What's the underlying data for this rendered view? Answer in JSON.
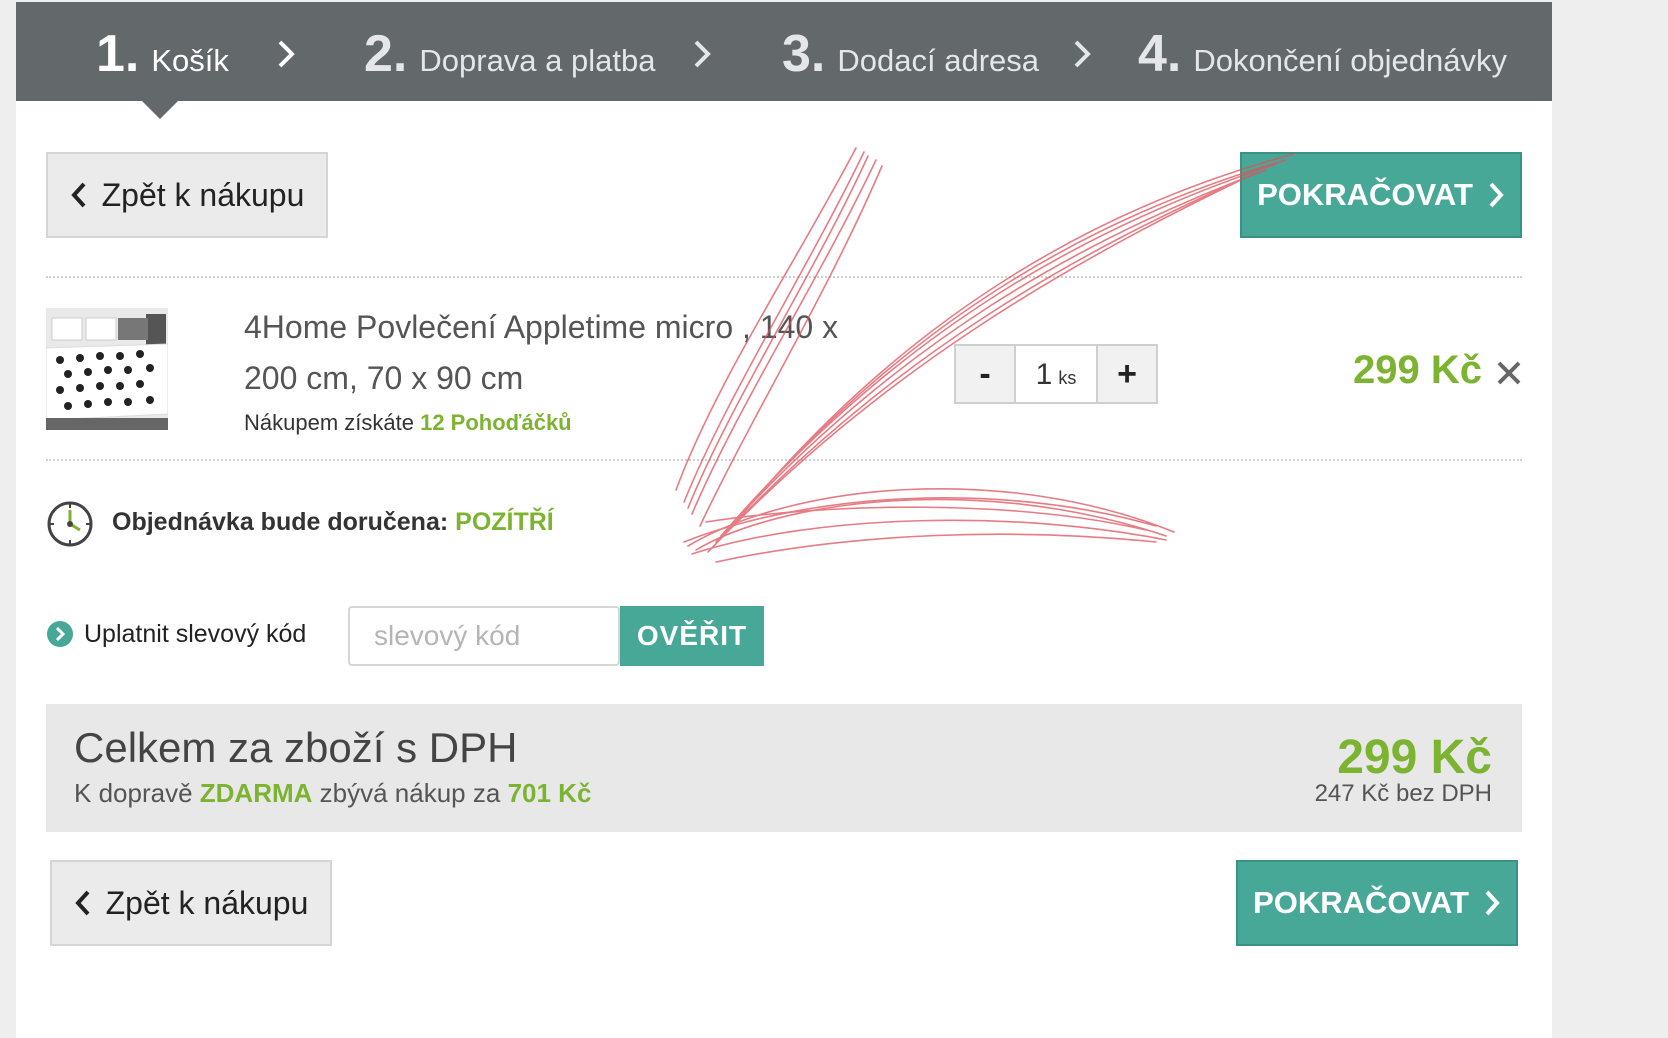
{
  "steps": [
    {
      "num": "1.",
      "label": "Košík"
    },
    {
      "num": "2.",
      "label": "Doprava a platba"
    },
    {
      "num": "3.",
      "label": "Dodací adresa"
    },
    {
      "num": "4.",
      "label": "Dokončení objednávky"
    }
  ],
  "buttons": {
    "back_label": "Zpět k nákupu",
    "continue_label": "POKRAČOVAT"
  },
  "product": {
    "name": "4Home Povlečení Appletime micro , 140 x 200 cm, 70 x 90 cm",
    "bonus_prefix": "Nákupem získáte",
    "bonus_value": "12 Pohoďáčků",
    "quantity": "1",
    "unit": "ks",
    "minus": "-",
    "plus": "+",
    "price": "299 Kč"
  },
  "delivery": {
    "label": "Objednávka bude doručena:",
    "value": "POZÍTŘÍ"
  },
  "coupon": {
    "label": "Uplatnit slevový kód",
    "placeholder": "slevový kód",
    "button": "OVĚŘIT"
  },
  "summary": {
    "title": "Celkem za zboží s DPH",
    "shipping_prefix": "K dopravě",
    "shipping_free": "ZDARMA",
    "shipping_middle": "zbývá nákup za",
    "shipping_remaining": "701 Kč",
    "total": "299 Kč",
    "without_vat": "247 Kč bez DPH"
  },
  "colors": {
    "header_bg": "#63686b",
    "accent_teal": "#48a898",
    "price_green": "#7cb331",
    "annotation_red": "#e0505a"
  }
}
